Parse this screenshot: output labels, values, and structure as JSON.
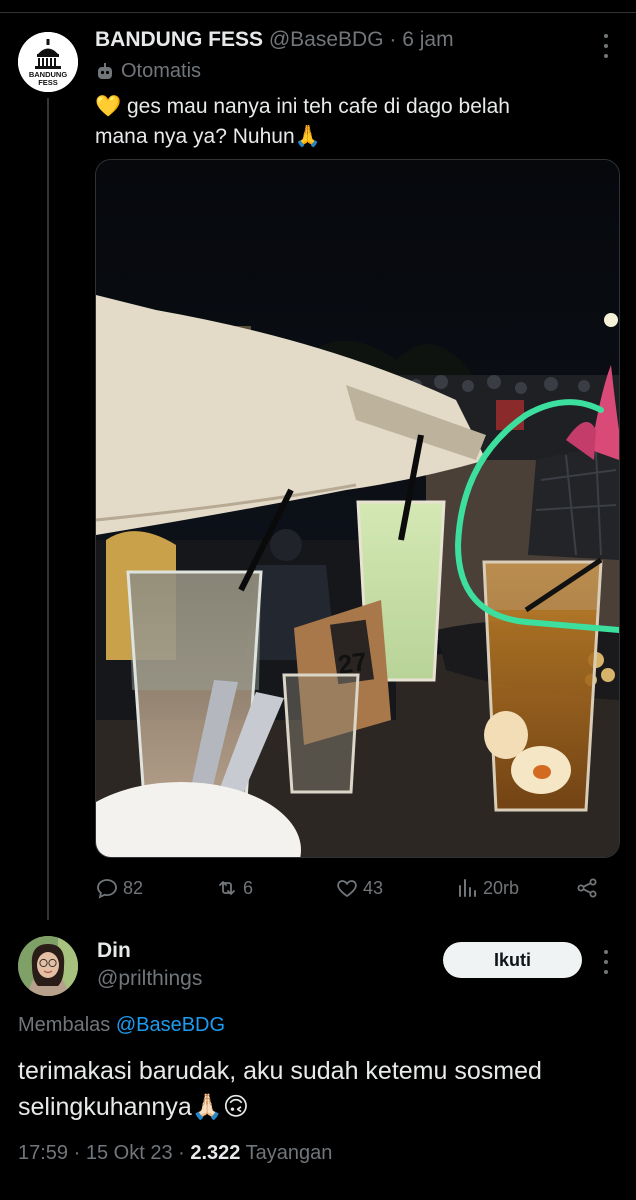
{
  "tweet": {
    "author_name": "BANDUNG FESS",
    "handle": "@BaseBDG",
    "separator": "·",
    "time": "6 jam",
    "automated_label": "Otomatis",
    "avatar_text_line1": "BANDUNG",
    "avatar_text_line2": "FESS",
    "text_line1": "💛 ges mau nanya ini teh cafe di dago belah",
    "text_line2": "mana nya ya? Nuhun🙏",
    "image_table_number": "27",
    "actions": {
      "replies": "82",
      "retweets": "6",
      "likes": "43",
      "views": "20rb"
    }
  },
  "reply": {
    "author_name": "Din",
    "handle": "@prilthings",
    "follow_label": "Ikuti",
    "replying_prefix": "Membalas",
    "replying_to": "@BaseBDG",
    "text_line1": "terimakasi barudak, aku sudah ketemu sosmed",
    "text_line2": "selingkuhannya🙏🏻🙃",
    "time": "17:59",
    "date": "15 Okt 23",
    "separator": "·",
    "views_count": "2.322",
    "views_label": "Tayangan"
  },
  "icons": {
    "more": "more-options-icon",
    "automated": "robot-icon",
    "reply": "reply-icon",
    "retweet": "retweet-icon",
    "like": "heart-icon",
    "views": "views-icon",
    "share": "share-icon"
  },
  "colors": {
    "background": "#000000",
    "text": "#e7e9ea",
    "secondary": "#71767b",
    "link": "#1d9bf0",
    "follow_bg": "#eff3f4",
    "highlight_circle": "#3ddf9f"
  }
}
